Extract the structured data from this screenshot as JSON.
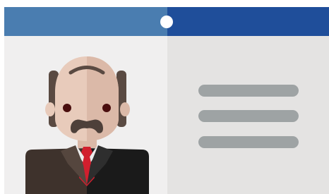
{
  "card": {
    "type": "id-card-illustration",
    "icons": {
      "hole": "punch-hole-icon",
      "avatar": "bald-man-mustache-avatar",
      "lines": "text-lines-placeholder"
    },
    "text_lines_count": 3,
    "colors": {
      "header_left": "#4a7db0",
      "header_right": "#1f4e9a",
      "body_left": "#f0efef",
      "body_right": "#e4e3e2",
      "line": "#9ea3a4",
      "skin": "#e8cbbb",
      "skin_shadow": "#dbb9a8",
      "hair": "#5a4a42",
      "suit_left": "#3e322c",
      "suit_right": "#1a1a1a",
      "tie": "#d11f2e",
      "shirt": "#ececec",
      "mustache": "#4e403a",
      "eye": "#4a0e0e",
      "hole": "#ffffff"
    }
  }
}
